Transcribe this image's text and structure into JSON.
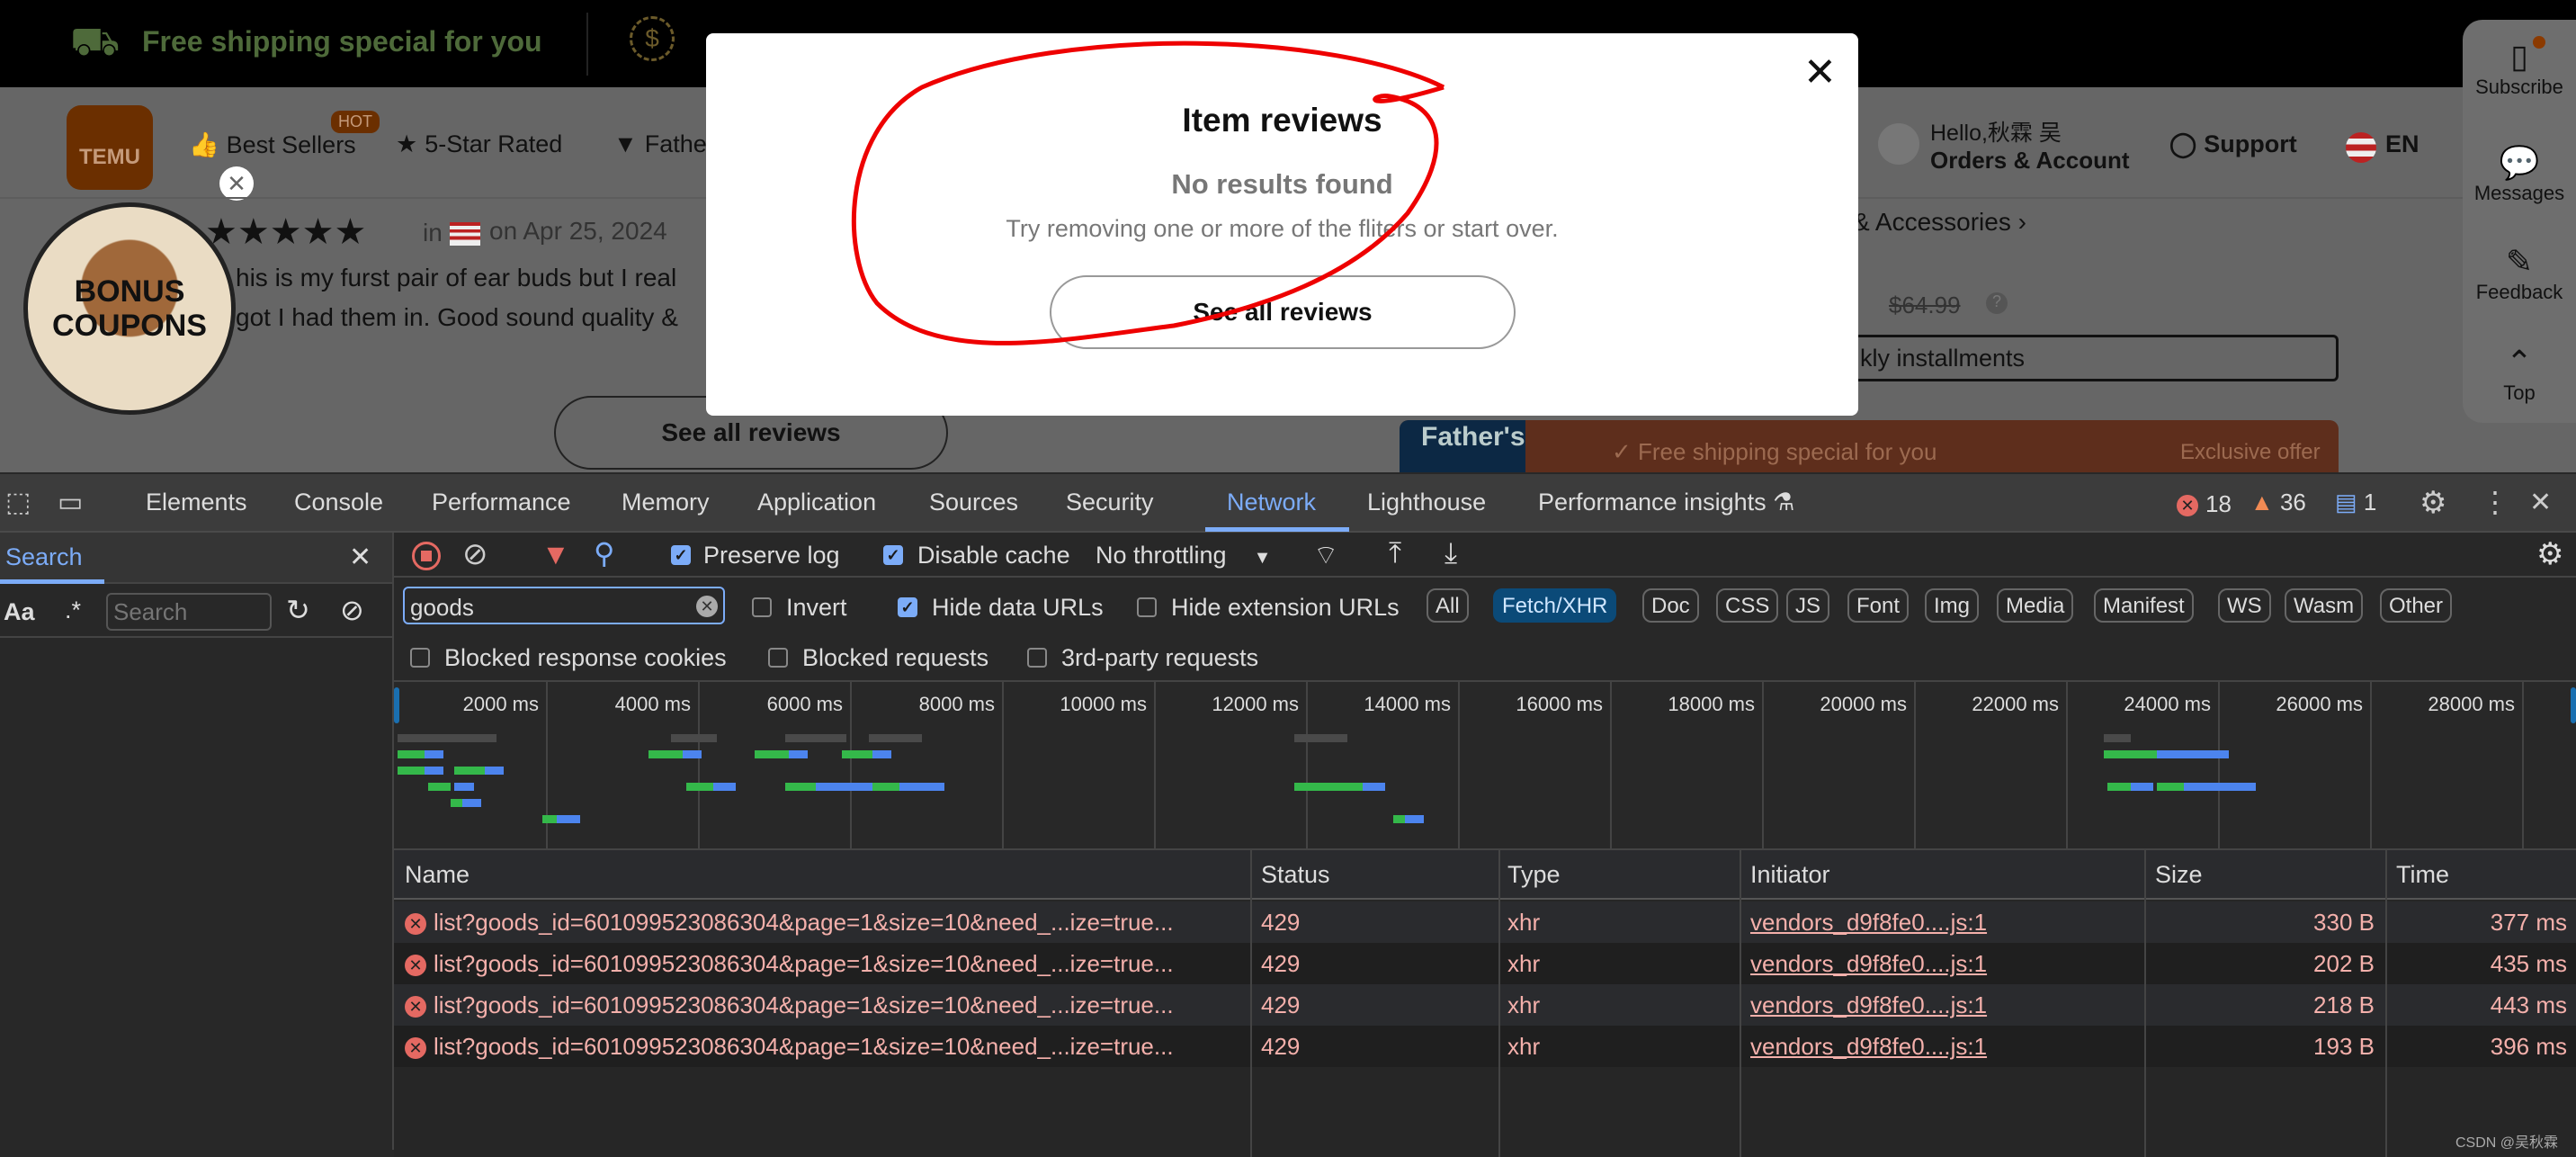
{
  "site": {
    "promo_shipping": "Free shipping special for you",
    "logo": "TEMU",
    "nav": {
      "best_sellers": "Best Sellers",
      "hot_badge": "HOT",
      "five_star": "5-Star Rated",
      "fathers": "Fathe",
      "hello": "Hello,秋霖 吴",
      "orders": "Orders & Account",
      "support": "Support",
      "lang": "EN"
    },
    "bonus": [
      "BONUS",
      "COUPONS"
    ],
    "review": {
      "in": "in",
      "date": "on Apr 25, 2024",
      "line1": "his is my furst pair of ear buds but I real",
      "line2": "got I had them in. Good sound quality &"
    },
    "see_all_reviews": "See all reviews",
    "breadcrumb_tail": "& Accessories",
    "old_price": "$64.99",
    "installments": "kly installments",
    "banner": {
      "brand": "Father's",
      "text": "Free shipping special for you",
      "offer": "Exclusive offer"
    },
    "rail": [
      "Subscribe",
      "Messages",
      "Feedback",
      "Top"
    ]
  },
  "modal": {
    "title": "Item reviews",
    "no_results": "No results found",
    "hint": "Try removing one or more of the fliters or start over.",
    "button": "See all reviews",
    "annotation_color": "#ee0000"
  },
  "devtools": {
    "tabs": [
      "Elements",
      "Console",
      "Performance",
      "Memory",
      "Application",
      "Sources",
      "Security",
      "Network",
      "Lighthouse",
      "Performance insights"
    ],
    "active_tab": "Network",
    "errors": "18",
    "warnings": "36",
    "messages": "1",
    "search_panel": {
      "title": "Search",
      "case": "Aa",
      "regex": ".*",
      "placeholder": "Search"
    },
    "toolbar": {
      "preserve_log": "Preserve log",
      "preserve_log_checked": true,
      "disable_cache": "Disable cache",
      "disable_cache_checked": true,
      "throttling": "No throttling"
    },
    "filter": {
      "value": "goods",
      "invert": "Invert",
      "hide_data_urls": "Hide data URLs",
      "hide_extension_urls": "Hide extension URLs",
      "types": [
        "All",
        "Fetch/XHR",
        "Doc",
        "CSS",
        "JS",
        "Font",
        "Img",
        "Media",
        "Manifest",
        "WS",
        "Wasm",
        "Other"
      ],
      "active_type": "Fetch/XHR",
      "blocked_cookies": "Blocked response cookies",
      "blocked_requests": "Blocked requests",
      "third_party": "3rd-party requests"
    },
    "timeline": {
      "ticks": [
        "2000 ms",
        "4000 ms",
        "6000 ms",
        "8000 ms",
        "10000 ms",
        "12000 ms",
        "14000 ms",
        "16000 ms",
        "18000 ms",
        "20000 ms",
        "22000 ms",
        "24000 ms",
        "26000 ms",
        "28000 ms"
      ],
      "bars": [
        {
          "lane": 0,
          "start": 0,
          "end": 1300,
          "kind": "wait"
        },
        {
          "lane": 1,
          "start": 0,
          "end": 350,
          "kind": "send"
        },
        {
          "lane": 1,
          "start": 350,
          "end": 600,
          "kind": "recv"
        },
        {
          "lane": 2,
          "start": 0,
          "end": 350,
          "kind": "send"
        },
        {
          "lane": 2,
          "start": 350,
          "end": 600,
          "kind": "recv"
        },
        {
          "lane": 2,
          "start": 750,
          "end": 1150,
          "kind": "send"
        },
        {
          "lane": 2,
          "start": 1150,
          "end": 1400,
          "kind": "recv"
        },
        {
          "lane": 3,
          "start": 400,
          "end": 700,
          "kind": "send"
        },
        {
          "lane": 3,
          "start": 750,
          "end": 1000,
          "kind": "recv"
        },
        {
          "lane": 4,
          "start": 700,
          "end": 850,
          "kind": "send"
        },
        {
          "lane": 4,
          "start": 850,
          "end": 1100,
          "kind": "recv"
        },
        {
          "lane": 5,
          "start": 1900,
          "end": 2100,
          "kind": "send"
        },
        {
          "lane": 5,
          "start": 2100,
          "end": 2400,
          "kind": "recv"
        },
        {
          "lane": 0,
          "start": 3600,
          "end": 4200,
          "kind": "wait"
        },
        {
          "lane": 1,
          "start": 3300,
          "end": 3750,
          "kind": "send"
        },
        {
          "lane": 1,
          "start": 3750,
          "end": 4000,
          "kind": "recv"
        },
        {
          "lane": 3,
          "start": 3800,
          "end": 4150,
          "kind": "send"
        },
        {
          "lane": 3,
          "start": 4150,
          "end": 4450,
          "kind": "recv"
        },
        {
          "lane": 0,
          "start": 5100,
          "end": 5900,
          "kind": "wait"
        },
        {
          "lane": 0,
          "start": 6200,
          "end": 6900,
          "kind": "wait"
        },
        {
          "lane": 1,
          "start": 4700,
          "end": 5150,
          "kind": "send"
        },
        {
          "lane": 1,
          "start": 5150,
          "end": 5400,
          "kind": "recv"
        },
        {
          "lane": 1,
          "start": 5850,
          "end": 6250,
          "kind": "send"
        },
        {
          "lane": 1,
          "start": 6250,
          "end": 6500,
          "kind": "recv"
        },
        {
          "lane": 3,
          "start": 5100,
          "end": 5500,
          "kind": "send"
        },
        {
          "lane": 3,
          "start": 5500,
          "end": 6300,
          "kind": "recv"
        },
        {
          "lane": 3,
          "start": 6250,
          "end": 6600,
          "kind": "send"
        },
        {
          "lane": 3,
          "start": 6600,
          "end": 7200,
          "kind": "recv"
        },
        {
          "lane": 0,
          "start": 11800,
          "end": 12500,
          "kind": "wait"
        },
        {
          "lane": 3,
          "start": 11800,
          "end": 12700,
          "kind": "send"
        },
        {
          "lane": 3,
          "start": 12700,
          "end": 13000,
          "kind": "recv"
        },
        {
          "lane": 5,
          "start": 13100,
          "end": 13250,
          "kind": "send"
        },
        {
          "lane": 5,
          "start": 13250,
          "end": 13500,
          "kind": "recv"
        },
        {
          "lane": 0,
          "start": 22450,
          "end": 22800,
          "kind": "wait"
        },
        {
          "lane": 1,
          "start": 22450,
          "end": 23150,
          "kind": "send"
        },
        {
          "lane": 1,
          "start": 23150,
          "end": 24100,
          "kind": "recv"
        },
        {
          "lane": 3,
          "start": 22500,
          "end": 22800,
          "kind": "send"
        },
        {
          "lane": 3,
          "start": 22800,
          "end": 23100,
          "kind": "recv"
        },
        {
          "lane": 3,
          "start": 23150,
          "end": 23500,
          "kind": "send"
        },
        {
          "lane": 3,
          "start": 23500,
          "end": 24450,
          "kind": "recv"
        }
      ],
      "colors": {
        "wait": "#4a4a4a",
        "send": "#34b84a",
        "recv": "#4c84ee"
      }
    },
    "table": {
      "columns": [
        "Name",
        "Status",
        "Type",
        "Initiator",
        "Size",
        "Time"
      ],
      "rows": [
        {
          "name": "list?goods_id=601099523086304&page=1&size=10&need_...ize=true...",
          "status": "429",
          "type": "xhr",
          "initiator": "vendors_d9f8fe0....js:1",
          "size": "330 B",
          "time": "377 ms"
        },
        {
          "name": "list?goods_id=601099523086304&page=1&size=10&need_...ize=true...",
          "status": "429",
          "type": "xhr",
          "initiator": "vendors_d9f8fe0....js:1",
          "size": "202 B",
          "time": "435 ms"
        },
        {
          "name": "list?goods_id=601099523086304&page=1&size=10&need_...ize=true...",
          "status": "429",
          "type": "xhr",
          "initiator": "vendors_d9f8fe0....js:1",
          "size": "218 B",
          "time": "443 ms"
        },
        {
          "name": "list?goods_id=601099523086304&page=1&size=10&need_...ize=true...",
          "status": "429",
          "type": "xhr",
          "initiator": "vendors_d9f8fe0....js:1",
          "size": "193 B",
          "time": "396 ms"
        }
      ]
    }
  },
  "watermark": "CSDN @吴秋霖"
}
